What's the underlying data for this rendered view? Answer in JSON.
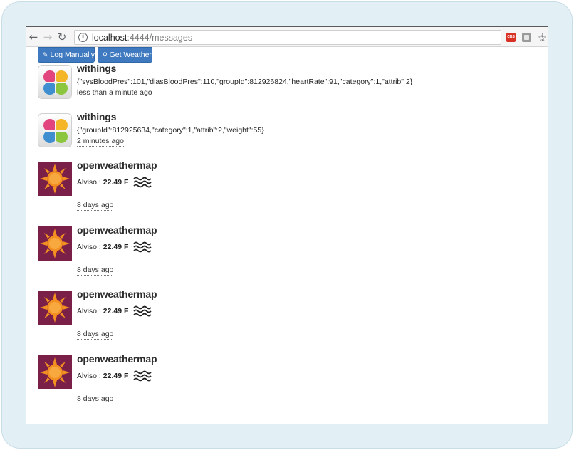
{
  "browser": {
    "url_host": "localhost",
    "url_rest": ":4444/messages",
    "extension_badge": "CBS"
  },
  "toolbar": {
    "log_manually": "Log Manually",
    "get_weather": "Get Weather"
  },
  "colors": {
    "button_blue": "#3f7ac0",
    "owm_bg": "#7a1f48",
    "owm_sun": "#f39021"
  },
  "messages": [
    {
      "source": "withings",
      "body": "{\"sysBloodPres\":101,\"diasBloodPres\":110,\"groupId\":812926824,\"heartRate\":91,\"category\":1,\"attrib\":2}",
      "time": "less than a minute ago"
    },
    {
      "source": "withings",
      "body": "{\"groupId\":812925634,\"category\":1,\"attrib\":2,\"weight\":55}",
      "time": "2 minutes ago"
    },
    {
      "source": "openweathermap",
      "place": "Alviso",
      "sep": " : ",
      "temp": "22.49 F",
      "time": "8 days ago"
    },
    {
      "source": "openweathermap",
      "place": "Alviso",
      "sep": " : ",
      "temp": "22.49 F",
      "time": "8 days ago"
    },
    {
      "source": "openweathermap",
      "place": "Alviso",
      "sep": " : ",
      "temp": "22.49 F",
      "time": "8 days ago"
    },
    {
      "source": "openweathermap",
      "place": "Alviso",
      "sep": " : ",
      "temp": "22.49 F",
      "time": "8 days ago"
    }
  ]
}
